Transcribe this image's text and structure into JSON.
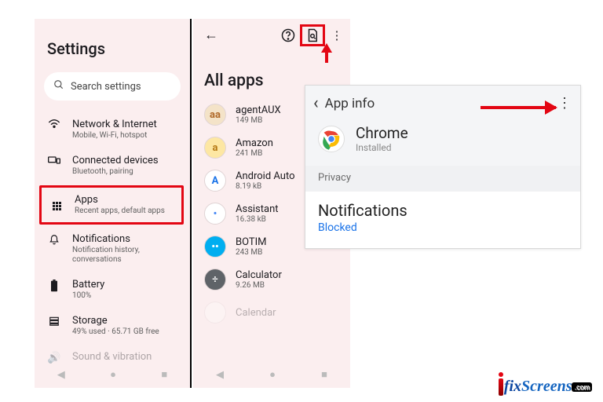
{
  "panel1": {
    "title": "Settings",
    "search_placeholder": "Search settings",
    "items": [
      {
        "label": "Network & Internet",
        "sub": "Mobile, Wi-Fi, hotspot"
      },
      {
        "label": "Connected devices",
        "sub": "Bluetooth, pairing"
      },
      {
        "label": "Apps",
        "sub": "Recent apps, default apps"
      },
      {
        "label": "Notifications",
        "sub": "Notification history, conversations"
      },
      {
        "label": "Battery",
        "sub": "100%"
      },
      {
        "label": "Storage",
        "sub": "49% used · 65.71 GB free"
      },
      {
        "label": "Sound & vibration",
        "sub": ""
      }
    ]
  },
  "panel2": {
    "title": "All apps",
    "apps": [
      {
        "name": "agentAUX",
        "size": "149 MB",
        "bg": "#f4e3c8",
        "fg": "#b06a2a",
        "initial": "aa"
      },
      {
        "name": "Amazon",
        "size": "241 MB",
        "bg": "#fde7a3",
        "fg": "#b77b17",
        "initial": "a"
      },
      {
        "name": "Android Auto",
        "size": "8.19 kB",
        "bg": "#ffffff",
        "fg": "#1a73e8",
        "initial": "A"
      },
      {
        "name": "Assistant",
        "size": "16.38 kB",
        "bg": "#ffffff",
        "fg": "#4285f4",
        "initial": "•"
      },
      {
        "name": "BOTIM",
        "size": "243 MB",
        "bg": "#00aef0",
        "fg": "#ffffff",
        "initial": "••"
      },
      {
        "name": "Calculator",
        "size": "9.26 MB",
        "bg": "#5f6368",
        "fg": "#ffffff",
        "initial": "÷"
      },
      {
        "name": "Calendar",
        "size": "",
        "bg": "#ffffff",
        "fg": "#1a73e8",
        "initial": ""
      }
    ]
  },
  "panel3": {
    "title": "App info",
    "app_name": "Chrome",
    "install_state": "Installed",
    "privacy_label": "Privacy",
    "notif_label": "Notifications",
    "notif_state": "Blocked"
  },
  "watermark": {
    "part1": "fix",
    "part2": "Screens",
    "tld": ".com"
  }
}
